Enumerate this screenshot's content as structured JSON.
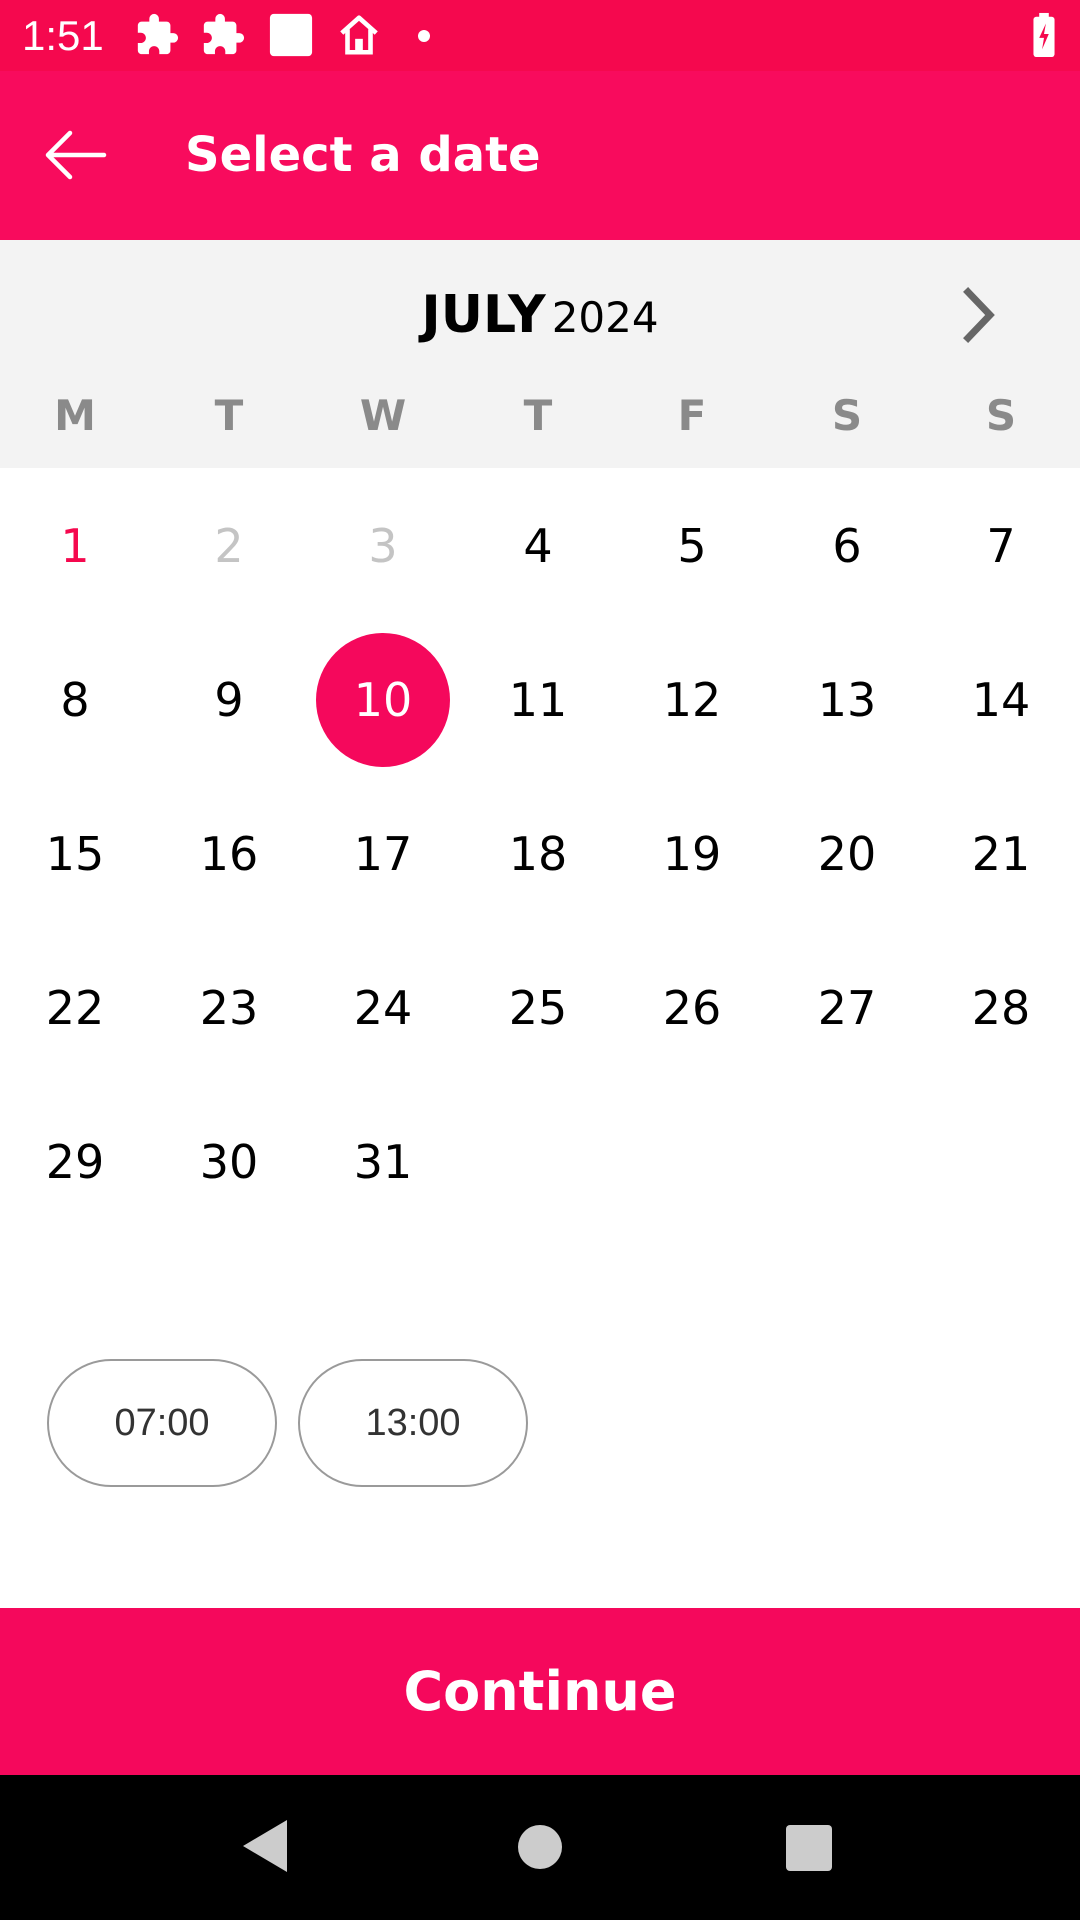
{
  "status_bar": {
    "time": "1:51",
    "icons": [
      "puzzle-icon",
      "puzzle-icon",
      "square-icon",
      "home-icon",
      "dot-icon",
      "battery-charging-icon"
    ]
  },
  "app_bar": {
    "back_icon": "arrow-left-icon",
    "title": "Select a date"
  },
  "calendar": {
    "month": "JULY",
    "year": "2024",
    "next_icon": "chevron-right-icon",
    "weekdays": [
      "M",
      "T",
      "W",
      "T",
      "F",
      "S",
      "S"
    ],
    "days": [
      {
        "label": "1",
        "state": "today"
      },
      {
        "label": "2",
        "state": "disabled"
      },
      {
        "label": "3",
        "state": "disabled"
      },
      {
        "label": "4",
        "state": "normal"
      },
      {
        "label": "5",
        "state": "normal"
      },
      {
        "label": "6",
        "state": "normal"
      },
      {
        "label": "7",
        "state": "normal"
      },
      {
        "label": "8",
        "state": "normal"
      },
      {
        "label": "9",
        "state": "normal"
      },
      {
        "label": "10",
        "state": "selected"
      },
      {
        "label": "11",
        "state": "normal"
      },
      {
        "label": "12",
        "state": "normal"
      },
      {
        "label": "13",
        "state": "normal"
      },
      {
        "label": "14",
        "state": "normal"
      },
      {
        "label": "15",
        "state": "normal"
      },
      {
        "label": "16",
        "state": "normal"
      },
      {
        "label": "17",
        "state": "normal"
      },
      {
        "label": "18",
        "state": "normal"
      },
      {
        "label": "19",
        "state": "normal"
      },
      {
        "label": "20",
        "state": "normal"
      },
      {
        "label": "21",
        "state": "normal"
      },
      {
        "label": "22",
        "state": "normal"
      },
      {
        "label": "23",
        "state": "normal"
      },
      {
        "label": "24",
        "state": "normal"
      },
      {
        "label": "25",
        "state": "normal"
      },
      {
        "label": "26",
        "state": "normal"
      },
      {
        "label": "27",
        "state": "normal"
      },
      {
        "label": "28",
        "state": "normal"
      },
      {
        "label": "29",
        "state": "normal"
      },
      {
        "label": "30",
        "state": "normal"
      },
      {
        "label": "31",
        "state": "normal"
      }
    ]
  },
  "time_slots": [
    "07:00",
    "13:00"
  ],
  "continue_label": "Continue",
  "nav_bar": {
    "icons": [
      "nav-back-icon",
      "nav-home-icon",
      "nav-recents-icon"
    ]
  },
  "colors": {
    "brand": "#f80b5d",
    "status_bar": "#f5084e",
    "today": "#f5084e",
    "selected": "#f5085c",
    "disabled": "#c4c4c4",
    "weekday": "#8a8a8a",
    "header_bg": "#f3f3f3"
  }
}
